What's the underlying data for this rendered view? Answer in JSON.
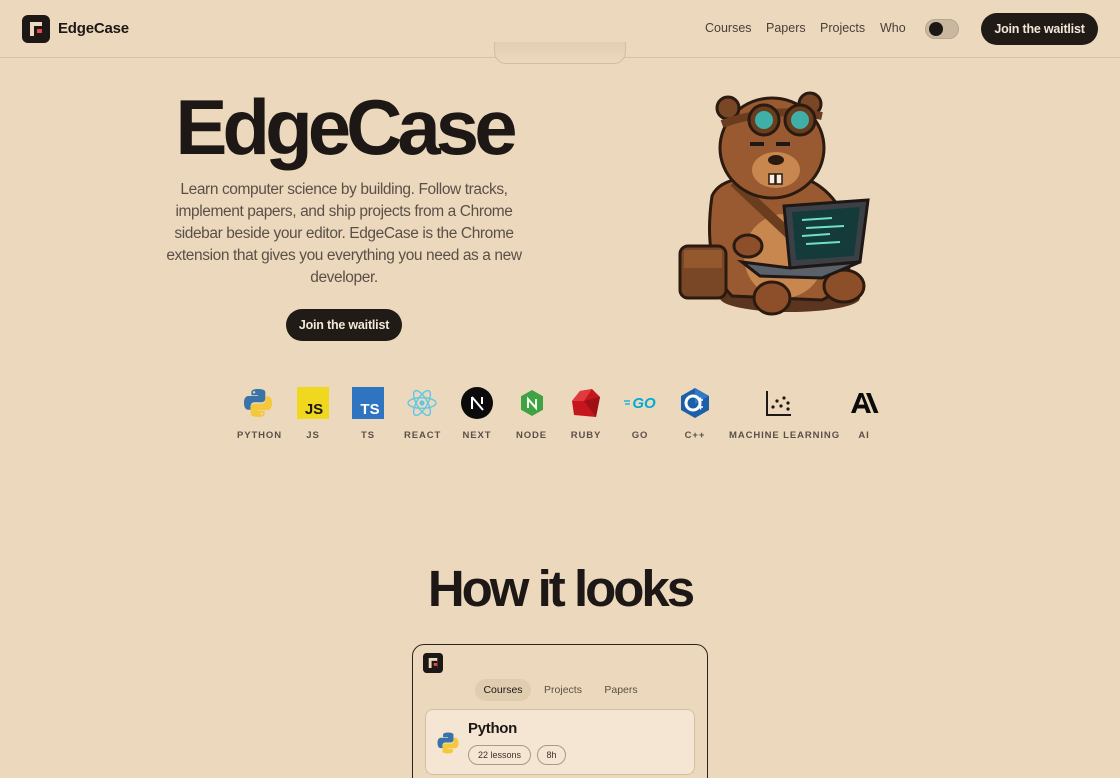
{
  "header": {
    "brand": "EdgeCase",
    "nav": [
      "Courses",
      "Papers",
      "Projects",
      "Who"
    ],
    "cta": "Join the waitlist"
  },
  "hero": {
    "title": "EdgeCase",
    "description": "Learn computer science by building. Follow tracks, implement papers, and ship projects from a Chrome sidebar beside your editor. EdgeCase is the Chrome extension that gives you everything you need as a new developer.",
    "cta": "Join the waitlist",
    "mascot": "beaver-with-goggles-and-laptop"
  },
  "tech": [
    {
      "label": "PYTHON",
      "icon": "python-icon"
    },
    {
      "label": "JS",
      "icon": "javascript-icon"
    },
    {
      "label": "TS",
      "icon": "typescript-icon"
    },
    {
      "label": "REACT",
      "icon": "react-icon"
    },
    {
      "label": "NEXT",
      "icon": "nextjs-icon"
    },
    {
      "label": "NODE",
      "icon": "nodejs-icon"
    },
    {
      "label": "RUBY",
      "icon": "ruby-icon"
    },
    {
      "label": "GO",
      "icon": "go-icon"
    },
    {
      "label": "C++",
      "icon": "cpp-icon"
    },
    {
      "label": "MACHINE LEARNING",
      "icon": "scatter-chart-icon"
    },
    {
      "label": "AI",
      "icon": "anthropic-icon"
    }
  ],
  "preview": {
    "title": "How it looks",
    "tabs": [
      "Courses",
      "Projects",
      "Papers"
    ],
    "active_tab": "Courses",
    "course": {
      "title": "Python",
      "lessons": "22 lessons",
      "duration": "8h"
    }
  },
  "colors": {
    "background": "#ecd9bd",
    "dark": "#211b17",
    "text_muted": "#5b5047"
  }
}
